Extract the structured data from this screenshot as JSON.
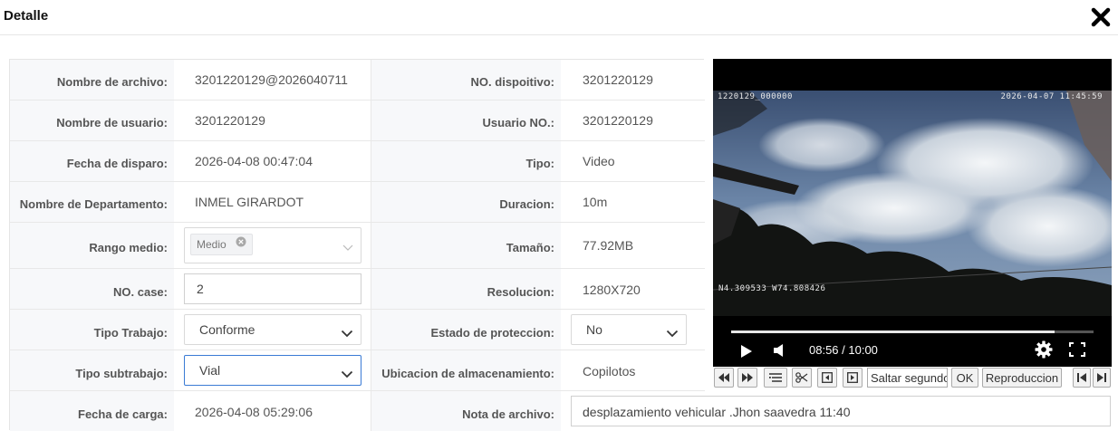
{
  "header": {
    "title": "Detalle"
  },
  "fields": {
    "file_name": {
      "label": "Nombre de archivo:",
      "value": "3201220129@2026040711"
    },
    "device_no": {
      "label": "NO. dispoitivo:",
      "value": "3201220129"
    },
    "user_name": {
      "label": "Nombre de usuario:",
      "value": "3201220129"
    },
    "user_no": {
      "label": "Usuario NO.:",
      "value": "3201220129"
    },
    "trigger_date": {
      "label": "Fecha de disparo:",
      "value": "2026-04-08 00:47:04"
    },
    "type": {
      "label": "Tipo:",
      "value": "Video"
    },
    "department": {
      "label": "Nombre de Departamento:",
      "value": "INMEL GIRARDOT"
    },
    "duration": {
      "label": "Duracion:",
      "value": "10m"
    },
    "media_range": {
      "label": "Rango medio:",
      "tag": "Medio"
    },
    "size": {
      "label": "Tamaño:",
      "value": "77.92MB"
    },
    "case_no": {
      "label": "NO. case:",
      "value": "2"
    },
    "resolution": {
      "label": "Resolucion:",
      "value": "1280X720"
    },
    "work_type": {
      "label": "Tipo Trabajo:",
      "value": "Conforme"
    },
    "protection": {
      "label": "Estado de proteccion:",
      "value": "No"
    },
    "work_subtype": {
      "label": "Tipo subtrabajo:",
      "value": "Vial"
    },
    "storage": {
      "label": "Ubicacion de almacenamiento:",
      "value": "Copilotos"
    },
    "upload_date": {
      "label": "Fecha de carga:",
      "value": "2026-04-08 05:29:06"
    },
    "file_note": {
      "label": "Nota de archivo:",
      "value": "desplazamiento vehicular .Jhon saavedra 11:40"
    }
  },
  "video": {
    "osd_id": "1220129_000000",
    "osd_datetime": "2026-04-07  11:45:59",
    "osd_gps": "N4.309533  W74.808426",
    "time": "08:56 / 10:00",
    "progress": 0.8933
  },
  "toolbar": {
    "skip_placeholder": "Saltar segundos",
    "ok_label": "OK",
    "playback_label": "Reproduccion"
  },
  "colors": {
    "label_bg": "#f7f8fa",
    "border": "#e8e8e8",
    "focus_border": "#3a7bd5"
  }
}
